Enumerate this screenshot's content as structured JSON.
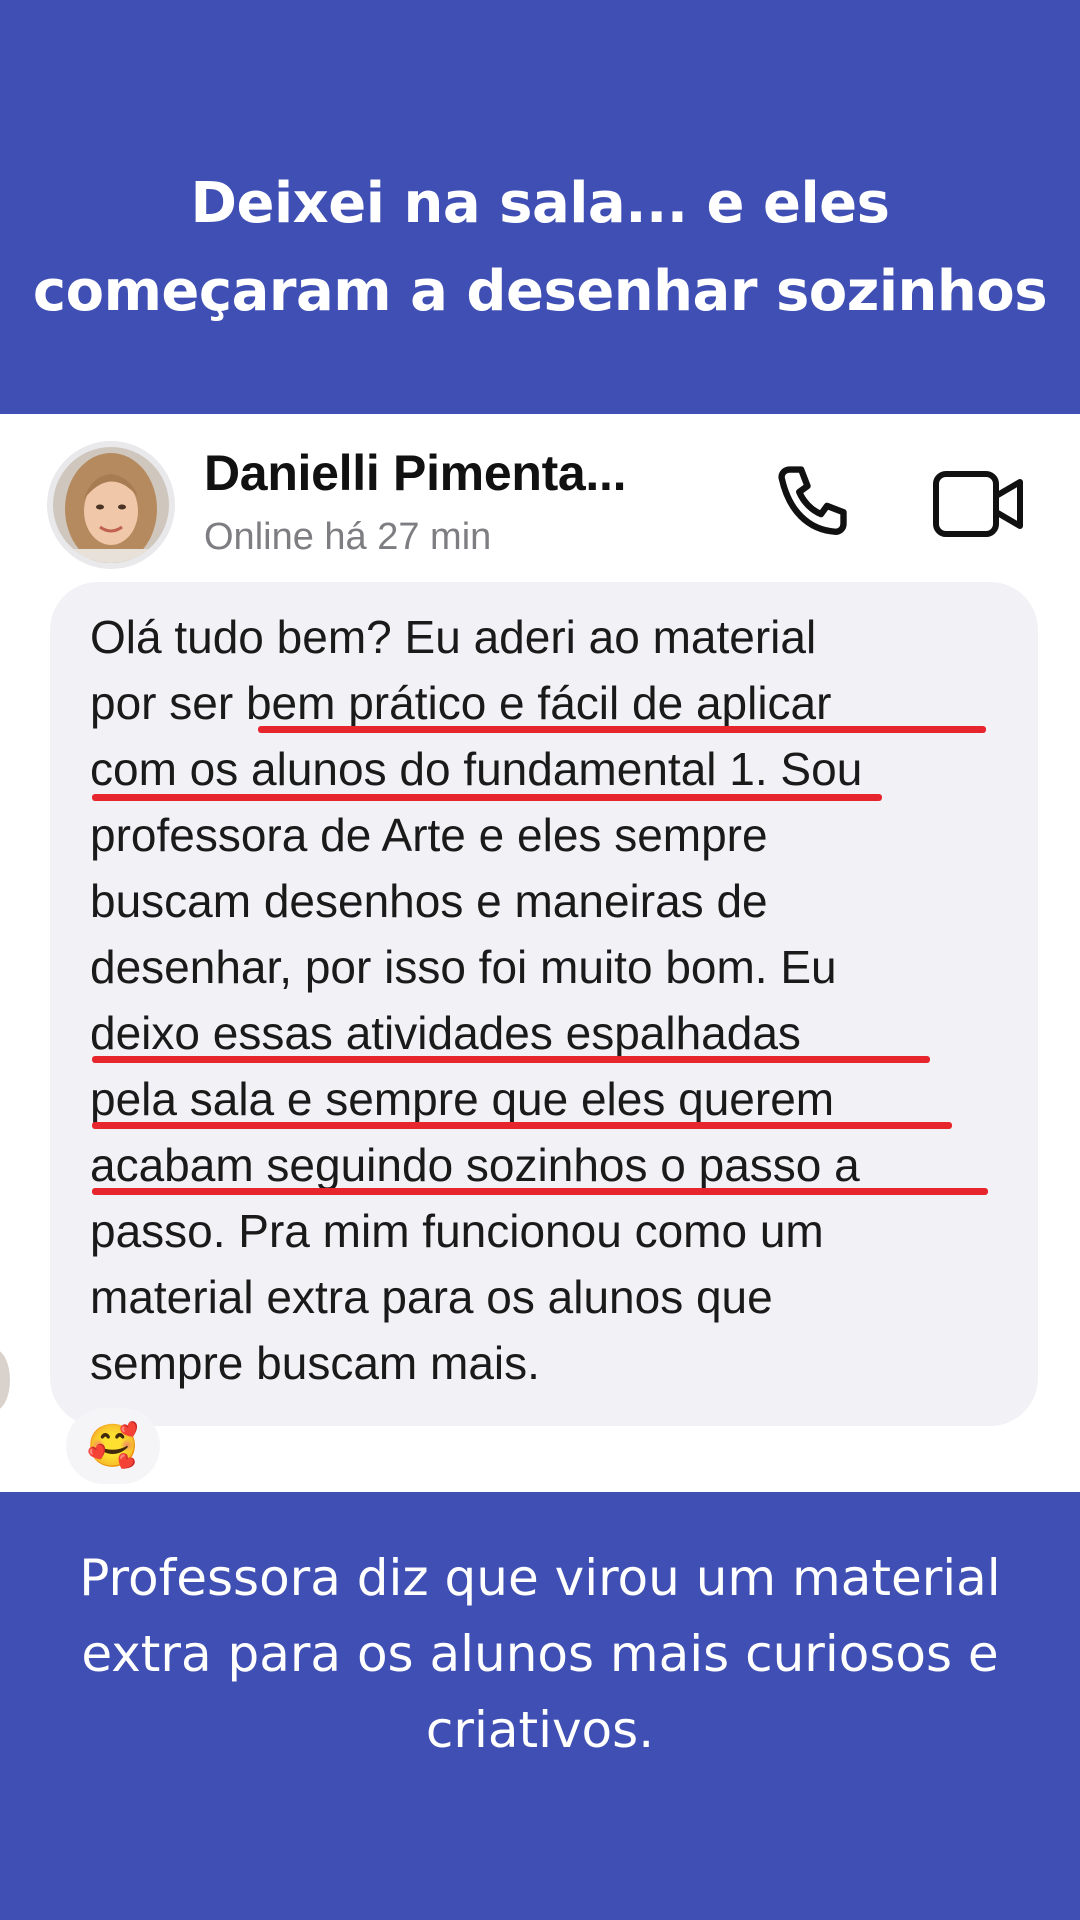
{
  "headline": {
    "line1": "Deixei na sala... e eles",
    "line2": "começaram a desenhar sozinhos"
  },
  "chat": {
    "contact_name": "Danielli Pimenta...",
    "status": "Online há 27 min",
    "icons": {
      "call": "phone-icon",
      "video": "video-camera-icon"
    },
    "message_lines": [
      "Olá tudo bem? Eu aderi ao material",
      "por ser bem prático e fácil de aplicar",
      "com os alunos do fundamental 1. Sou",
      "professora de Arte e eles sempre",
      "buscam desenhos e maneiras de",
      "desenhar, por isso foi muito bom. Eu",
      "deixo essas atividades espalhadas",
      "pela sala e sempre que eles querem",
      "acabam seguindo sozinhos o passo a",
      "passo. Pra mim funcionou como um",
      "material extra para os alunos que",
      "sempre buscam mais."
    ],
    "reaction": "🥰",
    "highlight_color": "#e6262c"
  },
  "caption": {
    "line1": "Professora diz que virou um material",
    "line2": "extra para os alunos mais curiosos e",
    "line3": "criativos."
  },
  "colors": {
    "background": "#3f4fb3",
    "bubble": "#f1f1f6"
  }
}
